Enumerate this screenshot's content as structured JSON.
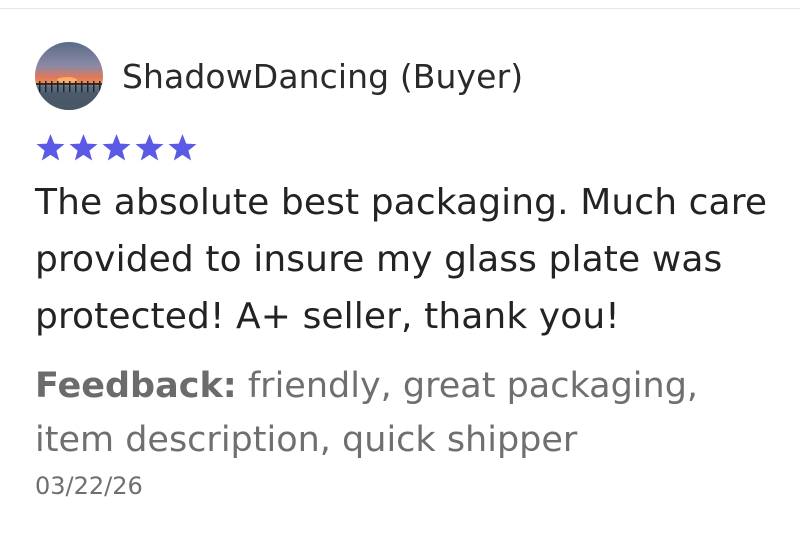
{
  "review": {
    "reviewer_name": "ShadowDancing (Buyer)",
    "rating": 5,
    "rating_max": 5,
    "star_color": "#5a5ae6",
    "text": "The absolute best packaging. Much care provided to insure my glass plate was protected! A+ seller, thank you!",
    "feedback_label": "Feedback:",
    "feedback_tags": "friendly, great packaging, item description, quick shipper",
    "date": "03/22/26"
  },
  "icons": {
    "avatar": "sunset-pier-photo",
    "star": "star-icon"
  }
}
